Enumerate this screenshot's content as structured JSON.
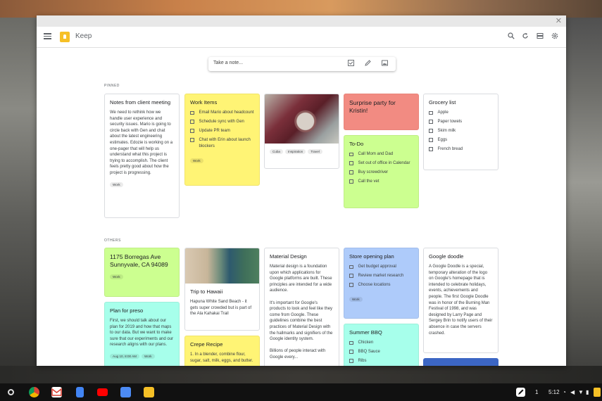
{
  "app": {
    "title": "Keep"
  },
  "note_input": {
    "placeholder": "Take a note..."
  },
  "sections": {
    "pinned": "PINNED",
    "others": "OTHERS"
  },
  "pinned": {
    "client_notes": {
      "title": "Notes from client meeting",
      "body": "We need to rethink how we handle user experience and security issues. Mario is going to circle back with Gen and chat about the latest engineering estimates. Edozie is working on a one-pager that will help us understand what this project is trying to accomplish. The client feels pretty good about how the project is progressing.",
      "label": "Work"
    },
    "work_items": {
      "title": "Work Items",
      "items": [
        "Email Mario about headcount",
        "Schedule sync with Gen",
        "Update PR team",
        "Chat with Erin about launch blockers"
      ],
      "label": "Work"
    },
    "car_photo": {
      "labels": [
        "Cuba",
        "Inspiration",
        "Travel"
      ]
    },
    "surprise_party": {
      "title": "Surprise party for Kristin!"
    },
    "todo": {
      "title": "To-Do",
      "items": [
        "Call Mom and Dad",
        "Set out of office in Calendar",
        "Buy screwdriver",
        "Call the vet"
      ]
    },
    "grocery": {
      "title": "Grocery list",
      "items": [
        "Apple",
        "Paper towels",
        "Skim milk",
        "Eggs",
        "French bread"
      ]
    }
  },
  "others": {
    "address": {
      "title": "1175 Borregas Ave Sunnyvale, CA 94089",
      "label": "Work"
    },
    "hawaii": {
      "title": "Trip to Hawaii",
      "body": "Hapuna White Sand Beach - it gets super crowded but is part of the Ala Kahakai Trail"
    },
    "material": {
      "title": "Material Design",
      "body": "Material design is a foundation upon which applications for Google platforms are built. These principles are intended for a wide audience.\n\nIt's important for Google's products to look and feel like they come from Google. These guidelines combine the best practices of Material Design with the hallmarks and signifiers of the Google identity system.\n\nBillions of people interact with Google every..."
    },
    "store": {
      "title": "Store opening plan",
      "items": [
        "Get budget approval",
        "Review market research",
        "Choose locations"
      ],
      "label": "Work"
    },
    "doodle": {
      "title": "Google doodle",
      "body": "A Google Doodle is a special, temporary alteration of the logo on Google's homepage that is intended to celebrate holidays, events, achievements and people. The first Google Doodle was in honor of the Burning Man Festival of 1998, and was designed by Larry Page and Sergey Brin to notify users of their absence in case the servers crashed."
    },
    "preso": {
      "title": "Plan for preso",
      "body": "First, we should talk about our plan for 2019 and how that maps to our data. But we want to make sure that our experiments and our research aligns with our plans.",
      "reminder": "Aug 10, 8:00 AM",
      "label": "Work"
    },
    "crepe": {
      "title": "Crepe Recipe",
      "body": "1. In a blender, combine flour, sugar, salt, milk, eggs, and butter."
    },
    "bbq": {
      "title": "Summer BBQ",
      "items": [
        "Chicken",
        "BBQ Sauce",
        "Ribs"
      ]
    }
  },
  "shelf": {
    "page_num": "1",
    "time": "5:12"
  },
  "colors": {
    "yellow": "#fff475",
    "red": "#f28b82",
    "green": "#ccff90",
    "teal": "#a7ffeb",
    "blue": "#aecbfa",
    "keep_brand": "#f6c026"
  }
}
